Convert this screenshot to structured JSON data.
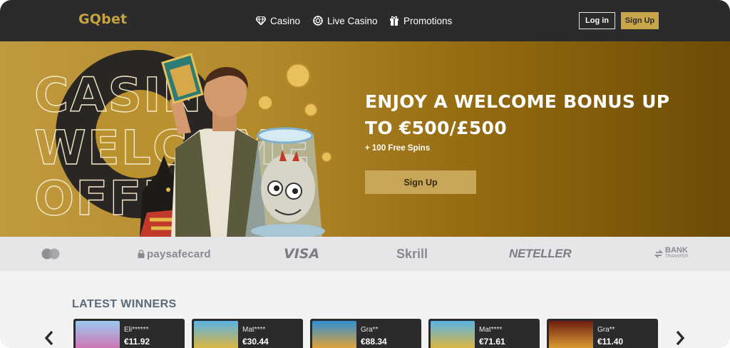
{
  "header": {
    "logo": "GQbet",
    "nav": [
      {
        "label": "Casino",
        "icon": "diamond-icon"
      },
      {
        "label": "Live Casino",
        "icon": "chip-icon"
      },
      {
        "label": "Promotions",
        "icon": "gift-icon"
      }
    ],
    "login_label": "Log in",
    "signup_label": "Sign Up"
  },
  "hero": {
    "title": "ENJOY A WELCOME BONUS UP TO €500/£500",
    "subtitle": "+ 100 Free Spins",
    "cta_label": "Sign Up",
    "bg_words": [
      "CASINO",
      "WELCOME",
      "OFFER"
    ]
  },
  "payments": [
    {
      "name": "mastercard",
      "icon": "mastercard-icon"
    },
    {
      "name": "paysafecard",
      "icon": "lock-icon"
    },
    {
      "name": "VISA"
    },
    {
      "name": "Skrill"
    },
    {
      "name": "NETELLER"
    },
    {
      "name": "BANK",
      "sub": "TRANSFER",
      "icon": "transfer-icon"
    }
  ],
  "winners": {
    "title": "LATEST WINNERS",
    "items": [
      {
        "name": "Eli******",
        "amount": "€11.92",
        "thumb_color": "#6fa6e0"
      },
      {
        "name": "Mat****",
        "amount": "€30.44",
        "thumb_color": "#4fa3d8"
      },
      {
        "name": "Gra**",
        "amount": "€88.34",
        "thumb_color": "#3a9ad6"
      },
      {
        "name": "Mat****",
        "amount": "€71.61",
        "thumb_color": "#4fa3d8"
      },
      {
        "name": "Gra**",
        "amount": "€11.40",
        "thumb_color": "#8a2a1a"
      }
    ]
  },
  "colors": {
    "header_bg": "#2b2b2d",
    "accent_gold": "#c9a64a",
    "winners_title": "#5a6a78"
  }
}
